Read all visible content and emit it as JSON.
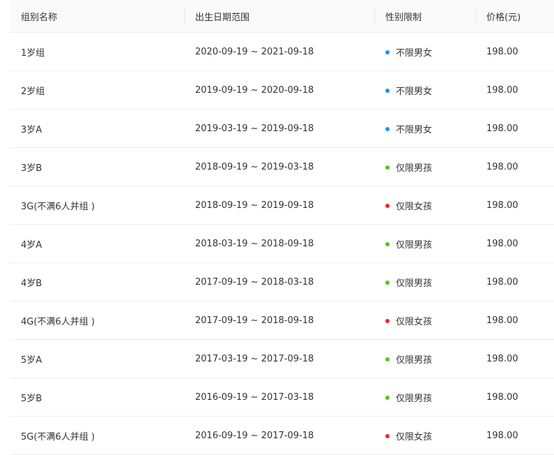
{
  "colors": {
    "any": "#1890ff",
    "boy": "#52c41a",
    "girl": "#f5222d"
  },
  "headers": {
    "group": "组别名称",
    "birth_range": "出生日期范围",
    "gender": "性别限制",
    "price": "价格(元)"
  },
  "rows": [
    {
      "group": "1岁组",
      "birth_range": "2020-09-19 ~ 2021-09-18",
      "gender": "不限男女",
      "gender_type": "any",
      "price": "198.00"
    },
    {
      "group": "2岁组",
      "birth_range": "2019-09-19 ~ 2020-09-18",
      "gender": "不限男女",
      "gender_type": "any",
      "price": "198.00"
    },
    {
      "group": "3岁A",
      "birth_range": "2019-03-19 ~ 2019-09-18",
      "gender": "不限男女",
      "gender_type": "any",
      "price": "198.00"
    },
    {
      "group": "3岁B",
      "birth_range": "2018-09-19 ~ 2019-03-18",
      "gender": "仅限男孩",
      "gender_type": "boy",
      "price": "198.00"
    },
    {
      "group": "3G(不满6人并组 )",
      "birth_range": "2018-09-19 ~ 2019-09-18",
      "gender": "仅限女孩",
      "gender_type": "girl",
      "price": "198.00"
    },
    {
      "group": "4岁A",
      "birth_range": "2018-03-19 ~ 2018-09-18",
      "gender": "仅限男孩",
      "gender_type": "boy",
      "price": "198.00"
    },
    {
      "group": "4岁B",
      "birth_range": "2017-09-19 ~ 2018-03-18",
      "gender": "仅限男孩",
      "gender_type": "boy",
      "price": "198.00"
    },
    {
      "group": "4G(不满6人并组 )",
      "birth_range": "2017-09-19 ~ 2018-09-18",
      "gender": "仅限女孩",
      "gender_type": "girl",
      "price": "198.00"
    },
    {
      "group": "5岁A",
      "birth_range": "2017-03-19 ~ 2017-09-18",
      "gender": "仅限男孩",
      "gender_type": "boy",
      "price": "198.00"
    },
    {
      "group": "5岁B",
      "birth_range": "2016-09-19 ~ 2017-03-18",
      "gender": "仅限男孩",
      "gender_type": "boy",
      "price": "198.00"
    },
    {
      "group": "5G(不满6人并组 )",
      "birth_range": "2016-09-19 ~ 2017-09-18",
      "gender": "仅限女孩",
      "gender_type": "girl",
      "price": "198.00"
    }
  ]
}
